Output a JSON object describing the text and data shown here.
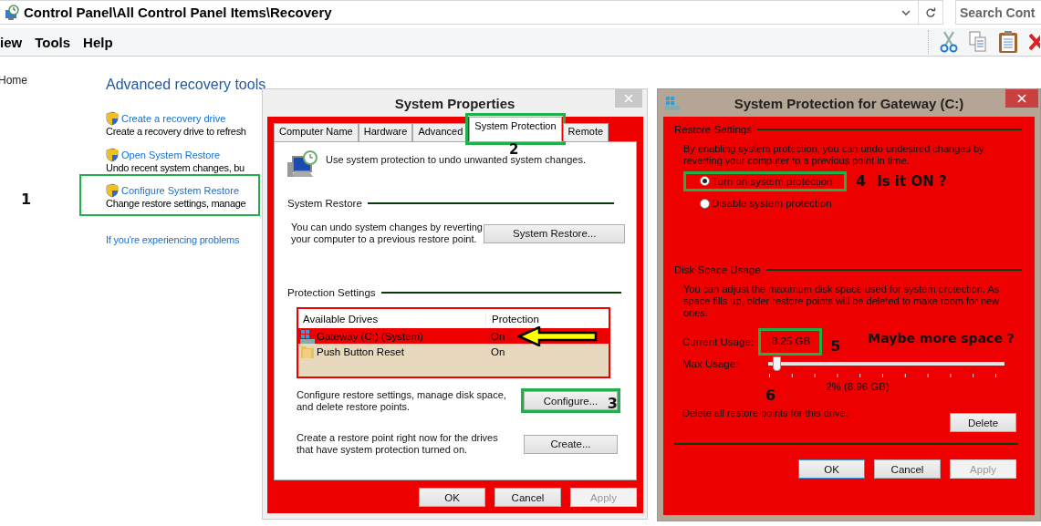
{
  "explorer": {
    "address": "Control Panel\\All Control Panel Items\\Recovery",
    "search": {
      "placeholder": "Search Cont"
    },
    "menu": [
      "iew",
      "Tools",
      "Help"
    ],
    "sidebar": {
      "items": [
        "Home"
      ]
    },
    "heading": "Advanced recovery tools",
    "tasks": [
      {
        "link": "Create a recovery drive",
        "description": "Create a recovery drive to refresh",
        "highlighted": false
      },
      {
        "link": "Open System Restore",
        "description": "Undo recent system changes, bu",
        "highlighted": false
      },
      {
        "link": "Configure System Restore",
        "description": "Change restore settings, manage",
        "highlighted": true,
        "marker": "1"
      }
    ],
    "help_link": "If you're experiencing problems"
  },
  "system_properties": {
    "title": "System Properties",
    "tabs": [
      {
        "label": "Computer Name",
        "selected": false,
        "highlighted": false
      },
      {
        "label": "Hardware",
        "selected": false,
        "highlighted": false
      },
      {
        "label": "Advanced",
        "selected": false,
        "highlighted": false
      },
      {
        "label": "System Protection",
        "selected": true,
        "highlighted": true,
        "marker": "2"
      },
      {
        "label": "Remote",
        "selected": false,
        "highlighted": false
      }
    ],
    "intro": "Use system protection to undo unwanted system changes.",
    "system_restore": {
      "heading": "System Restore",
      "text": "You can undo system changes by reverting your computer to a previous restore point.",
      "button": "System Restore..."
    },
    "protection": {
      "heading": "Protection Settings",
      "columns": [
        "Available Drives",
        "Protection"
      ],
      "drives": [
        {
          "name": "Gateway (C:) (System)",
          "protection": "On",
          "kind": "system",
          "selected": true,
          "pointed": true
        },
        {
          "name": "Push Button Reset",
          "protection": "On",
          "kind": "folder",
          "selected": false,
          "pointed": false
        }
      ],
      "configure_text": "Configure restore settings, manage disk space, and delete restore points.",
      "configure_button": {
        "label": "Configure...",
        "highlighted": true,
        "marker": "3"
      },
      "create_text": "Create a restore point right now for the drives that have system protection turned on.",
      "create_button": "Create..."
    },
    "buttons": [
      {
        "label": "OK",
        "disabled": false
      },
      {
        "label": "Cancel",
        "disabled": false
      },
      {
        "label": "Apply",
        "disabled": true
      }
    ]
  },
  "protection_dialog": {
    "title": "System Protection for Gateway (C:)",
    "restore_settings": {
      "heading": "Restore Settings",
      "text": "By enabling system protection, you can undo undesired changes by reverting your computer to a previous point in time.",
      "options": [
        {
          "label": "Turn on system protection",
          "selected": true,
          "highlighted": true,
          "marker": "4",
          "note": "Is it ON ?"
        },
        {
          "label": "Disable system protection",
          "selected": false,
          "highlighted": false
        }
      ]
    },
    "disk_space": {
      "heading": "Disk Space Usage",
      "text": "You can adjust the maximum disk space used for system protection. As space fills up, older restore points will be deleted to make room for new ones.",
      "current_label": "Current Usage:",
      "current_value": {
        "text": "8.25 GB",
        "highlighted": true,
        "marker": "5"
      },
      "note": "Maybe more space ?",
      "max_label": "Max Usage:",
      "slider": {
        "level": 0.02,
        "marker": "6"
      },
      "reading": "2% (8.96 GB)",
      "delete_text": "Delete all restore points for this drive.",
      "delete_button": "Delete"
    },
    "buttons": [
      {
        "label": "OK",
        "disabled": false,
        "default": true
      },
      {
        "label": "Cancel",
        "disabled": false,
        "default": false
      },
      {
        "label": "Apply",
        "disabled": true,
        "default": false
      }
    ]
  }
}
